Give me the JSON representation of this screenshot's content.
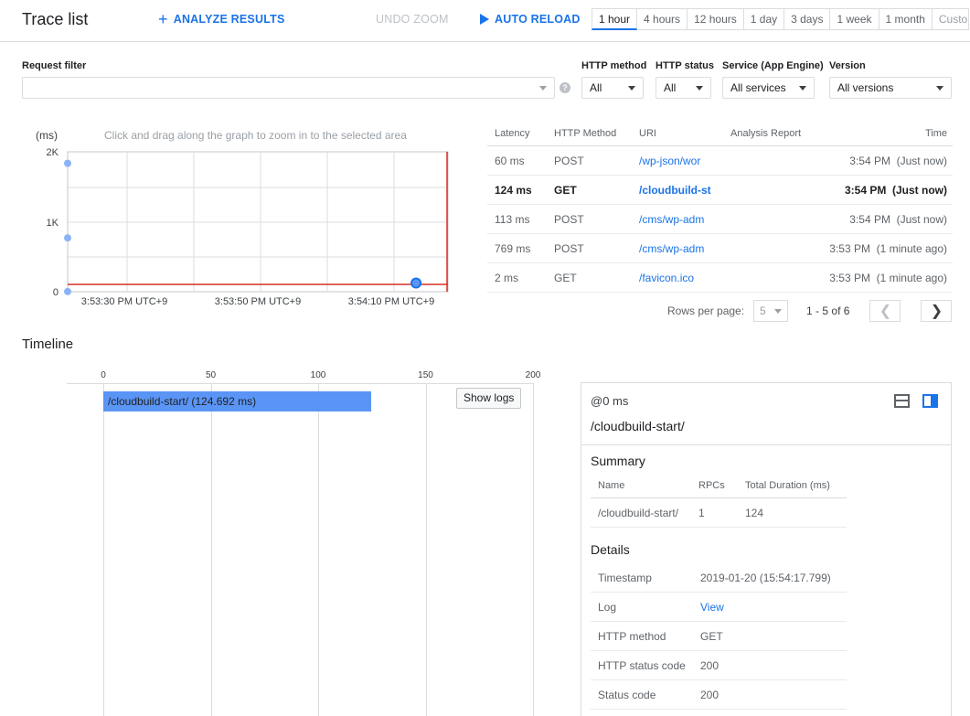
{
  "header": {
    "title": "Trace list",
    "analyze_label": "ANALYZE RESULTS",
    "undo_zoom_label": "UNDO ZOOM",
    "auto_reload_label": "AUTO RELOAD",
    "ranges": [
      "1 hour",
      "4 hours",
      "12 hours",
      "1 day",
      "3 days",
      "1 week",
      "1 month",
      "Custom"
    ]
  },
  "filters": {
    "request_filter_label": "Request filter",
    "request_filter_value": "",
    "http_method_label": "HTTP method",
    "http_method_value": "All",
    "http_status_label": "HTTP status",
    "http_status_value": "All",
    "service_label": "Service (App Engine)",
    "service_value": "All services",
    "version_label": "Version",
    "version_value": "All versions"
  },
  "chart": {
    "y_unit": "(ms)",
    "hint": "Click and drag along the graph to zoom in to the selected area",
    "y_ticks": [
      "2K",
      "1K",
      "0"
    ],
    "x_ticks": [
      "3:53:30 PM UTC+9",
      "3:53:50 PM UTC+9",
      "3:54:10 PM UTC+9"
    ]
  },
  "chart_data": {
    "type": "scatter",
    "ylabel": "(ms)",
    "ylim": [
      0,
      2000
    ],
    "y_ticks": [
      0,
      1000,
      2000
    ],
    "x_ticks": [
      "3:53:30 PM UTC+9",
      "3:53:50 PM UTC+9",
      "3:54:10 PM UTC+9"
    ],
    "grid": true,
    "points": [
      {
        "x": "3:53:19 PM",
        "y": 1835
      },
      {
        "x": "3:53:23 PM",
        "y": 769
      },
      {
        "x": "3:53:23 PM",
        "y": 2
      },
      {
        "x": "3:54:17 PM",
        "y": 124
      }
    ]
  },
  "table": {
    "headers": [
      "Latency",
      "HTTP Method",
      "URI",
      "Analysis Report",
      "Time"
    ],
    "rows": [
      {
        "latency": "60 ms",
        "method": "POST",
        "uri": "/wp-json/wor",
        "report": "",
        "time": "3:54 PM  (Just now)",
        "bold": false
      },
      {
        "latency": "124 ms",
        "method": "GET",
        "uri": "/cloudbuild-st",
        "report": "",
        "time": "3:54 PM  (Just now)",
        "bold": true
      },
      {
        "latency": "113 ms",
        "method": "POST",
        "uri": "/cms/wp-adm",
        "report": "",
        "time": "3:54 PM  (Just now)",
        "bold": false
      },
      {
        "latency": "769 ms",
        "method": "POST",
        "uri": "/cms/wp-adm",
        "report": "",
        "time": "3:53 PM  (1 minute ago)",
        "bold": false
      },
      {
        "latency": "2 ms",
        "method": "GET",
        "uri": "/favicon.ico",
        "report": "",
        "time": "3:53 PM  (1 minute ago)",
        "bold": false
      }
    ],
    "rows_per_page_label": "Rows per page:",
    "rows_per_page_value": "5",
    "range_text": "1 - 5 of 6"
  },
  "timeline": {
    "title": "Timeline",
    "ticks": [
      "0",
      "50",
      "100",
      "150",
      "200"
    ],
    "bar_label": "/cloudbuild-start/ (124.692 ms)",
    "bar_start_ms": 0,
    "bar_duration_ms": 124.692,
    "axis_max_ms": 200,
    "show_logs_label": "Show logs"
  },
  "detail": {
    "offset": "@0 ms",
    "name": "/cloudbuild-start/",
    "summary_title": "Summary",
    "summary_headers": [
      "Name",
      "RPCs",
      "Total Duration (ms)"
    ],
    "summary_row": [
      "/cloudbuild-start/",
      "1",
      "124"
    ],
    "details_title": "Details",
    "details": [
      {
        "k": "Timestamp",
        "v": "2019-01-20 (15:54:17.799)",
        "link": false
      },
      {
        "k": "Log",
        "v": "View",
        "link": true
      },
      {
        "k": "HTTP method",
        "v": "GET",
        "link": false
      },
      {
        "k": "HTTP status code",
        "v": "200",
        "link": false
      },
      {
        "k": "Status code",
        "v": "200",
        "link": false
      }
    ]
  },
  "colors": {
    "accent": "#1a73e8",
    "bar": "#5a95f5",
    "point": "#8ab4f8",
    "red_line": "#d93025"
  }
}
